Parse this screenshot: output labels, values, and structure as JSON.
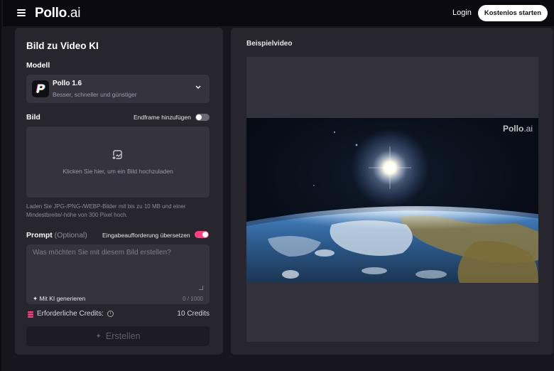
{
  "header": {
    "brand": "Pollo",
    "brand_suffix": ".ai",
    "login_label": "Login",
    "cta_label": "Kostenlos starten"
  },
  "form": {
    "title": "Bild zu Video KI",
    "model_label": "Modell",
    "model": {
      "name": "Pollo 1.6",
      "description": "Besser, schneller und günstiger",
      "logo_letter": "P"
    },
    "image_label": "Bild",
    "endframe_toggle": {
      "label": "Endframe hinzufügen",
      "on": false
    },
    "upload_text": "Klicken Sie hier, um ein Bild hochzuladen",
    "upload_hint": "Laden Sie JPG-/PNG-/WEBP-Bilder mit bis zu 10 MB und einer Mindestbreite/-höhe von 300 Pixel hoch.",
    "prompt_label": "Prompt",
    "prompt_optional": "(Optional)",
    "translate_toggle": {
      "label": "Eingabeaufforderung übersetzen",
      "on": true
    },
    "prompt_placeholder": "Was möchten Sie mit diesem Bild erstellen?",
    "generate_ki_label": "Mit KI generieren",
    "char_counter": "0 / 1000",
    "credits_label": "Erforderliche Credits:",
    "credits_value": "10 Credits",
    "create_label": "Erstellen"
  },
  "preview": {
    "title": "Beispielvideo",
    "watermark": "Pollo",
    "watermark_suffix": ".ai"
  },
  "colors": {
    "accent": "#ff3d7f",
    "panel": "#27262f",
    "field": "#35343e"
  }
}
